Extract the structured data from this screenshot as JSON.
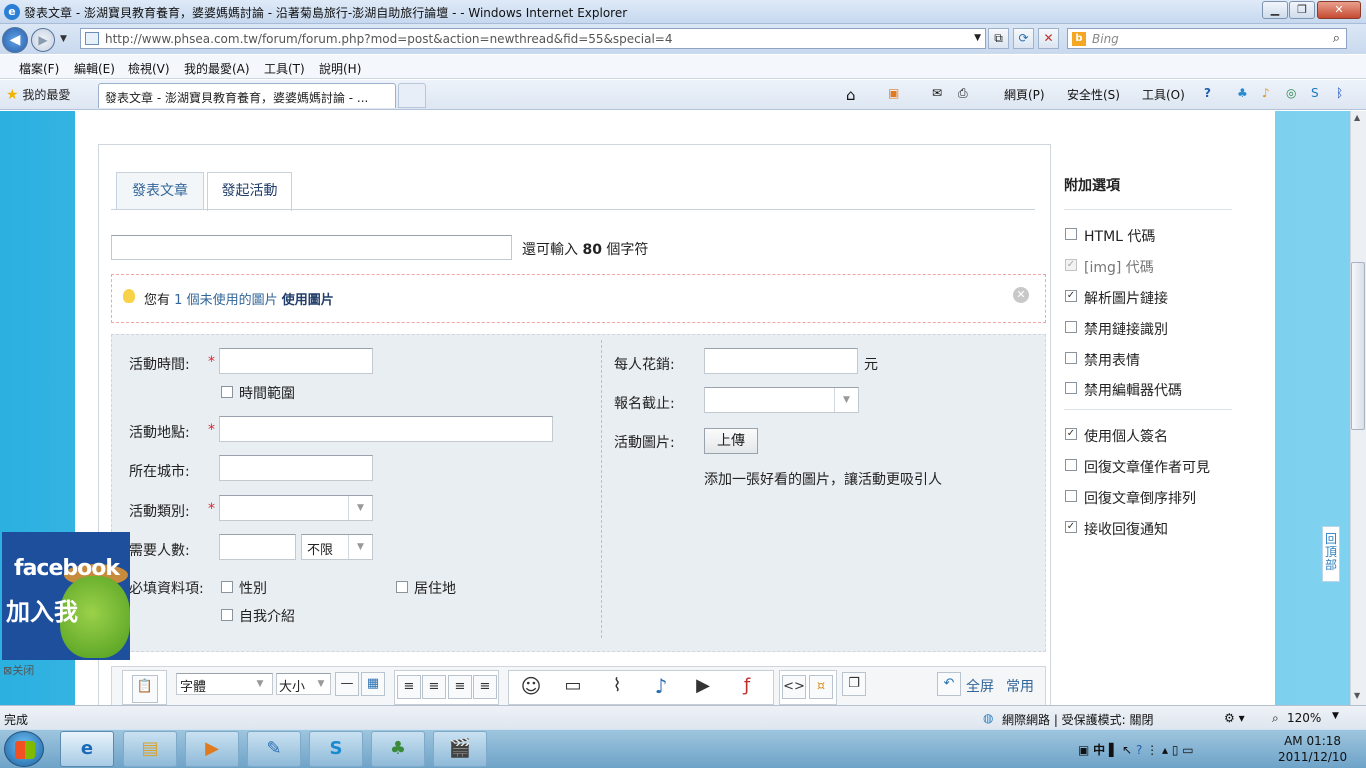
{
  "window": {
    "title": "發表文章 - 澎湖寶貝教育養育，婆婆媽媽討論 - 沿著菊島旅行-澎湖自助旅行論壇 - - Windows Internet Explorer",
    "minimize": "▁",
    "maximize": "❐",
    "close": "✕"
  },
  "browser": {
    "address": "http://www.phsea.com.tw/forum/forum.php?mod=post&action=newthread&fid=55&special=4",
    "search_placeholder": "Bing",
    "menu": [
      "檔案(F)",
      "編輯(E)",
      "檢視(V)",
      "我的最愛(A)",
      "工具(T)",
      "說明(H)"
    ],
    "favorites_label": "我的最愛",
    "tab_title": "發表文章 - 澎湖寶貝教育養育，婆婆媽媽討論 - ...",
    "toolbar": {
      "page": "網頁(P)",
      "safety": "安全性(S)",
      "tools": "工具(O)"
    }
  },
  "form": {
    "tabs": [
      "發表文章",
      "發起活動"
    ],
    "active_tab": 1,
    "remaining_prefix": "還可輸入",
    "remaining_count": "80",
    "remaining_suffix": "個字符",
    "notice": {
      "prefix": "您有",
      "count": "1",
      "middle": "個未使用的圖片",
      "link": "使用圖片"
    },
    "event": {
      "time_label": "活動時間:",
      "time_range": "時間範圍",
      "place_label": "活動地點:",
      "city_label": "所在城市:",
      "category_label": "活動類別:",
      "people_label": "需要人數:",
      "people_select": "不限",
      "required_label": "必填資料項:",
      "gender": "性別",
      "residence": "居住地",
      "intro": "自我介紹",
      "cost_label": "每人花銷:",
      "cost_unit": "元",
      "deadline_label": "報名截止:",
      "image_label": "活動圖片:",
      "upload": "上傳",
      "image_hint": "添加一張好看的圖片，讓活動更吸引人"
    },
    "editor": {
      "font": "字體",
      "size": "大小",
      "fullscreen": "全屏",
      "common": "常用"
    }
  },
  "sidebar": {
    "title": "附加選項",
    "options": [
      {
        "label": "HTML 代碼",
        "checked": false,
        "disabled": false
      },
      {
        "label": "[img] 代碼",
        "checked": true,
        "disabled": true
      },
      {
        "label": "解析圖片鏈接",
        "checked": true,
        "disabled": false
      },
      {
        "label": "禁用鏈接識別",
        "checked": false,
        "disabled": false
      },
      {
        "label": "禁用表情",
        "checked": false,
        "disabled": false
      },
      {
        "label": "禁用編輯器代碼",
        "checked": false,
        "disabled": false
      },
      {
        "label": "使用個人簽名",
        "checked": true,
        "disabled": false
      },
      {
        "label": "回復文章僅作者可見",
        "checked": false,
        "disabled": false
      },
      {
        "label": "回復文章倒序排列",
        "checked": false,
        "disabled": false
      },
      {
        "label": "接收回復通知",
        "checked": true,
        "disabled": false
      }
    ]
  },
  "facebook": {
    "brand": "facebook",
    "cta": "加入我",
    "close": "关闭"
  },
  "backtop": "回頂部",
  "status": {
    "done": "完成",
    "zone": "網際網路 | 受保護模式: 關閉",
    "zoom": "120%"
  },
  "taskbar": {
    "ime": "中",
    "time": "AM 01:18",
    "date": "2011/12/10"
  }
}
